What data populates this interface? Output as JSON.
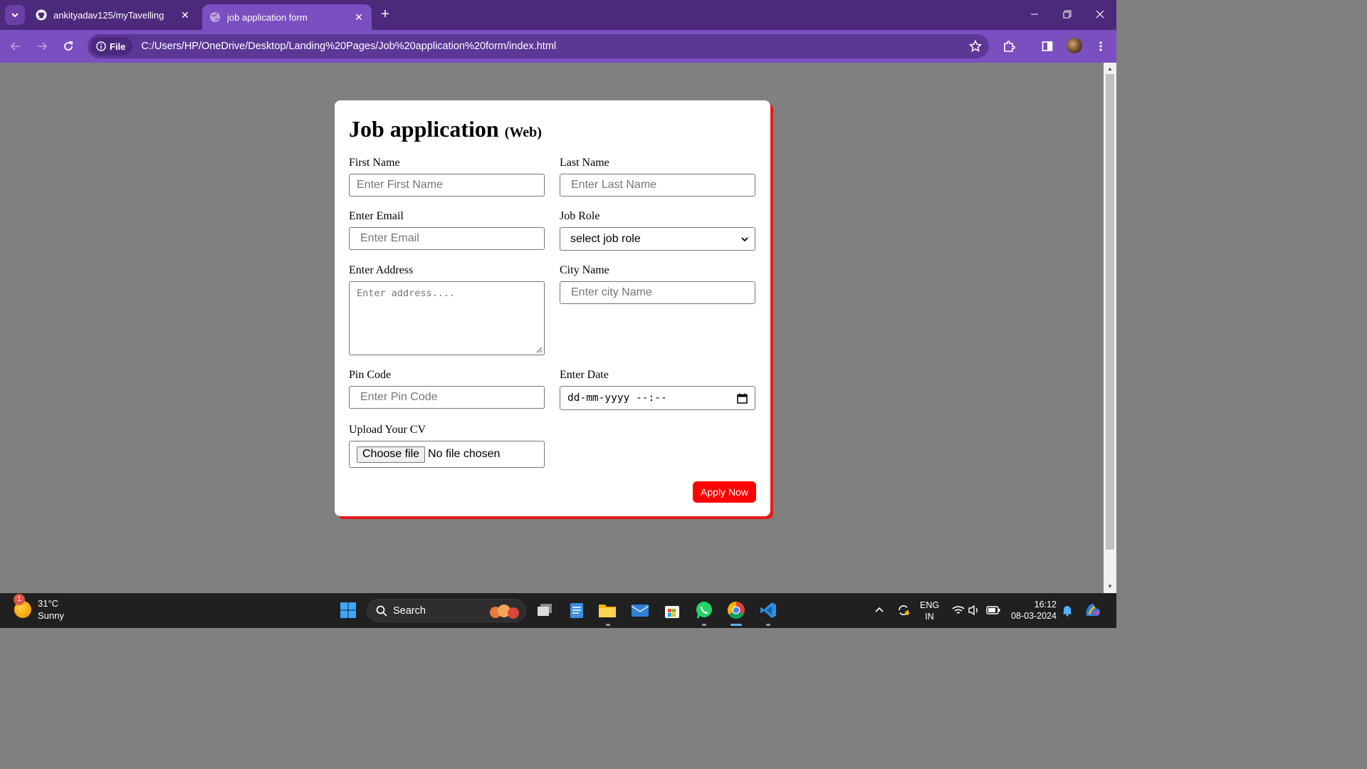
{
  "browser": {
    "tabs": [
      {
        "title": "ankityadav125/myTavelling",
        "icon": "github-icon",
        "active": false
      },
      {
        "title": "job application form",
        "icon": "globe-icon",
        "active": true
      }
    ],
    "site_chip": "File",
    "url": "C:/Users/HP/OneDrive/Desktop/Landing%20Pages/Job%20application%20form/index.html",
    "theme_color": "#7a4fc0"
  },
  "form": {
    "title": "Job application",
    "title_suffix": "(Web)",
    "fields": {
      "first_name": {
        "label": "First Name",
        "placeholder": "Enter First Name"
      },
      "last_name": {
        "label": "Last Name",
        "placeholder": "Enter Last Name"
      },
      "email": {
        "label": "Enter Email",
        "placeholder": "Enter Email"
      },
      "job_role": {
        "label": "Job Role",
        "selected": "select job role"
      },
      "address": {
        "label": "Enter Address",
        "placeholder": "Enter address...."
      },
      "city": {
        "label": "City Name",
        "placeholder": "Enter city Name"
      },
      "pin_code": {
        "label": "Pin Code",
        "placeholder": "Enter Pin Code"
      },
      "date": {
        "label": "Enter Date",
        "placeholder": "dd-mm-yyyy --:--"
      },
      "cv": {
        "label": "Upload Your CV",
        "button": "Choose file",
        "status": "No file chosen"
      }
    },
    "submit_label": "Apply Now",
    "accent_color": "#ff0000"
  },
  "taskbar": {
    "weather": {
      "temp": "31°C",
      "condition": "Sunny",
      "badge": "1"
    },
    "search_label": "Search",
    "language": {
      "line1": "ENG",
      "line2": "IN"
    },
    "clock": {
      "time": "16:12",
      "date": "08-03-2024"
    }
  }
}
